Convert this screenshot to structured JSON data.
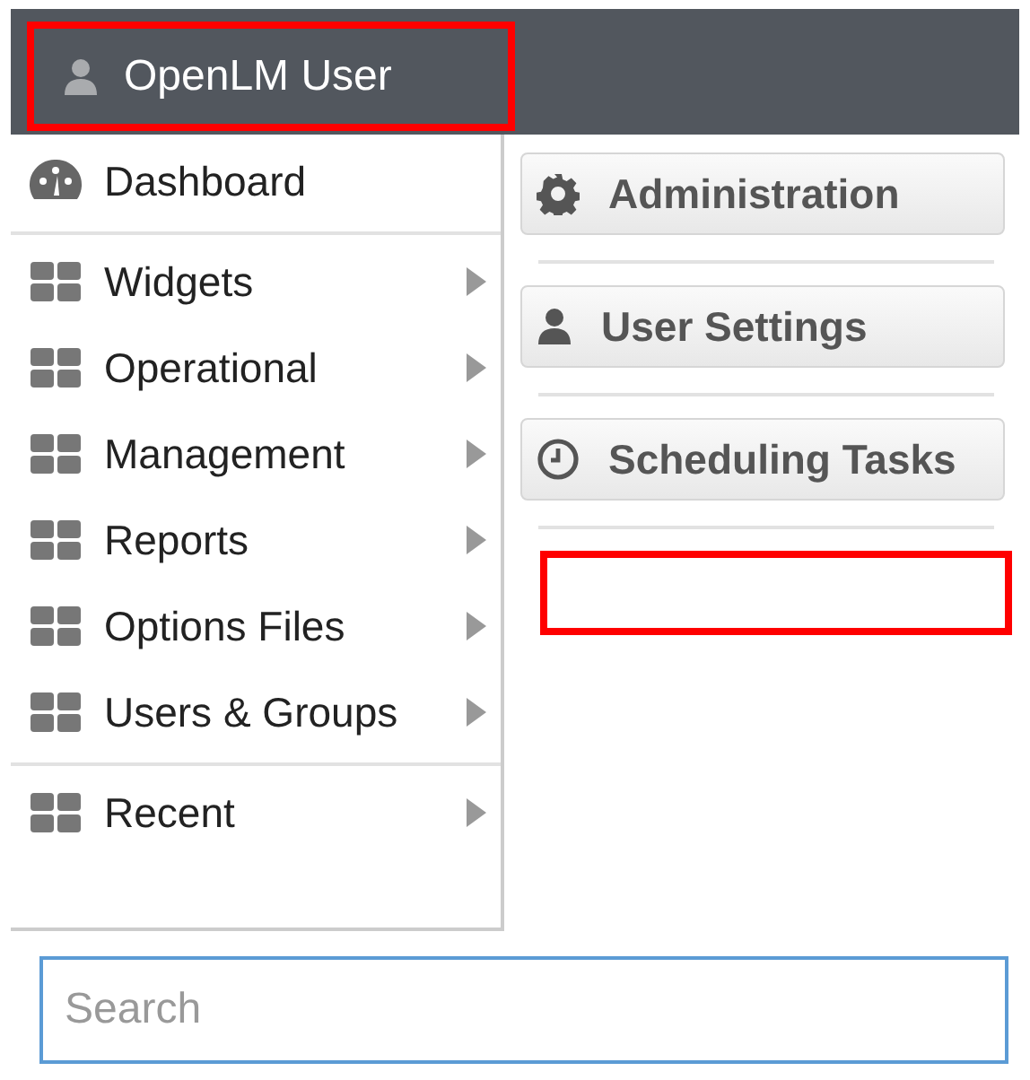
{
  "header": {
    "user_label": "OpenLM User",
    "highlighted": true
  },
  "menu": {
    "sections": [
      [
        {
          "label": "Dashboard",
          "kind": "dashboard",
          "has_submenu": false
        }
      ],
      [
        {
          "label": "Widgets",
          "kind": "group",
          "has_submenu": true
        },
        {
          "label": "Operational",
          "kind": "group",
          "has_submenu": true
        },
        {
          "label": "Management",
          "kind": "group",
          "has_submenu": true
        },
        {
          "label": "Reports",
          "kind": "group",
          "has_submenu": true
        },
        {
          "label": "Options Files",
          "kind": "group",
          "has_submenu": true
        },
        {
          "label": "Users & Groups",
          "kind": "group",
          "has_submenu": true
        }
      ],
      [
        {
          "label": "Recent",
          "kind": "group",
          "has_submenu": true
        }
      ]
    ]
  },
  "panel": {
    "buttons": [
      {
        "label": "Administration",
        "kind": "gear"
      },
      {
        "label": "User Settings",
        "kind": "person"
      },
      {
        "label": "Scheduling Tasks",
        "kind": "clock"
      }
    ],
    "empty_highlight": true
  },
  "search": {
    "placeholder": "Search"
  }
}
